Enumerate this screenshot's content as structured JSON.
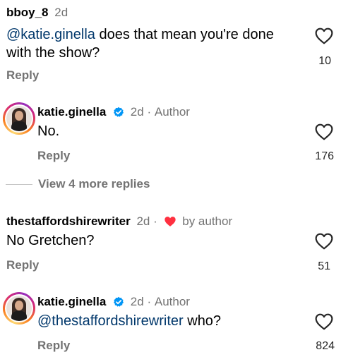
{
  "comments": [
    {
      "username": "bboy_8",
      "time": "2d",
      "mention": "@katie.ginella",
      "text_line1": " does that mean you're done",
      "text_line2": "with the show?",
      "reply_label": "Reply",
      "likes": "10"
    },
    {
      "username": "katie.ginella",
      "time": "2d",
      "author_tag": "Author",
      "text": "No.",
      "reply_label": "Reply",
      "likes": "176",
      "view_more": "View 4 more replies"
    },
    {
      "username": "thestaffordshirewriter",
      "time": "2d",
      "liked_by": "by author",
      "text": "No Gretchen?",
      "reply_label": "Reply",
      "likes": "51"
    },
    {
      "username": "katie.ginella",
      "time": "2d",
      "author_tag": "Author",
      "mention": "@thestaffordshirewriter",
      "text": " who?",
      "reply_label": "Reply",
      "likes": "824"
    }
  ],
  "separator": "·",
  "colors": {
    "mention": "#00376b",
    "verified": "#0095f6",
    "liked_heart": "#ff3040",
    "meta": "#737373"
  },
  "icons": {
    "like": "heart-outline-icon",
    "verified": "verified-badge-icon",
    "liked_by_author": "heart-filled-icon"
  }
}
